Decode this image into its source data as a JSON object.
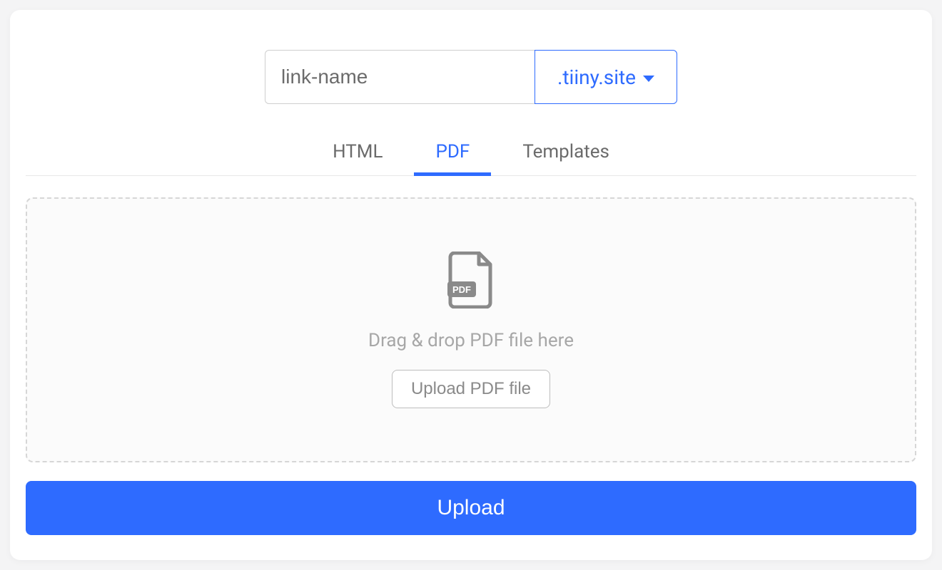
{
  "url": {
    "placeholder": "link-name",
    "domain": ".tiiny.site"
  },
  "tabs": {
    "html": "HTML",
    "pdf": "PDF",
    "templates": "Templates",
    "active": "pdf"
  },
  "dropzone": {
    "text": "Drag & drop PDF file here",
    "button": "Upload PDF file"
  },
  "submit": "Upload"
}
